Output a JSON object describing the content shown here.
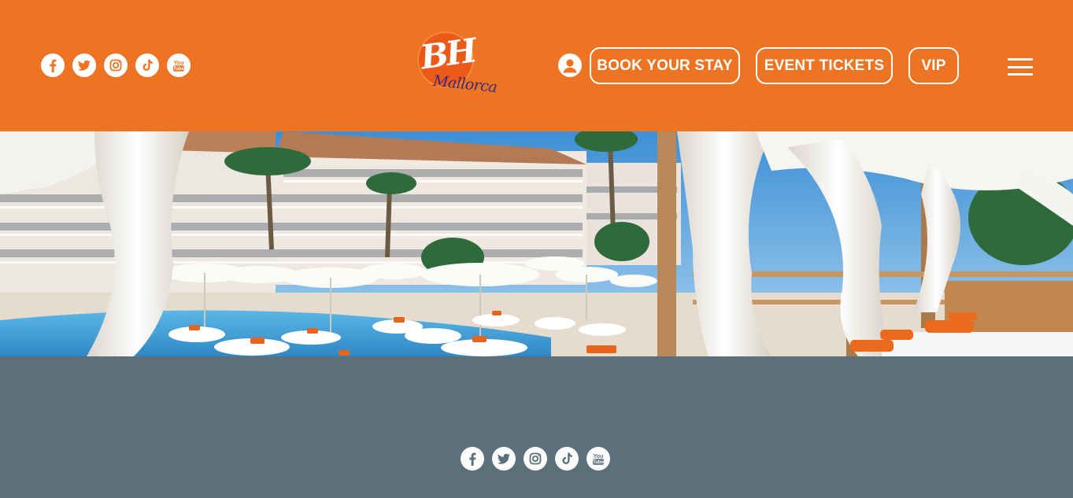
{
  "header": {
    "background": "#ec7422",
    "social_icons": [
      "facebook-icon",
      "twitter-icon",
      "instagram-icon",
      "tiktok-icon",
      "youtube-icon"
    ],
    "logo": {
      "mark": "BH",
      "script": "Mallorca"
    },
    "account_icon": "user-icon",
    "nav": {
      "book_label": "BOOK YOUR STAY",
      "events_label": "EVENT TICKETS",
      "vip_label": "VIP"
    },
    "menu_icon": "hamburger-icon"
  },
  "hero": {
    "content": "photo-hotel-pool-with-white-umbrellas-and-cabanas"
  },
  "footer": {
    "background": "#5c707c",
    "social_icons": [
      "facebook-icon",
      "twitter-icon",
      "instagram-icon",
      "tiktok-icon",
      "youtube-icon"
    ]
  }
}
